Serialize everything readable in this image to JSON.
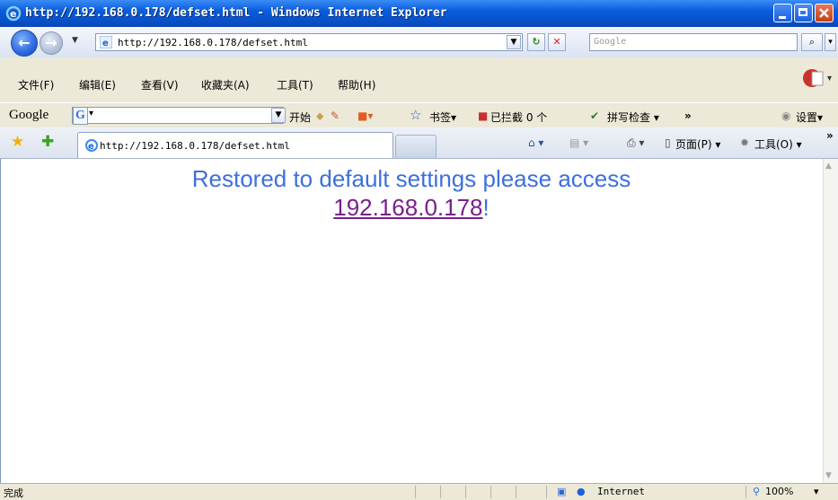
{
  "window": {
    "title": "http://192.168.0.178/defset.html - Windows Internet Explorer"
  },
  "address_bar": {
    "url": "http://192.168.0.178/defset.html",
    "search_placeholder": "Google"
  },
  "menu": {
    "items": [
      "文件(F)",
      "编辑(E)",
      "查看(V)",
      "收藏夹(A)",
      "工具(T)",
      "帮助(H)"
    ]
  },
  "google_toolbar": {
    "logo": "Google",
    "start_label": "开始",
    "bookmarks_label": "书签▾",
    "blocked_label": "已拦截 0 个",
    "spellcheck_label": "拼写检查 ▾",
    "more_label": "»",
    "settings_label": "设置▾"
  },
  "tab_row": {
    "tab_title": "http://192.168.0.178/defset.html",
    "page_menu": "页面(P) ▾",
    "tools_menu": "工具(O) ▾",
    "more": "»"
  },
  "content": {
    "message": "Restored to default settings please access",
    "link": "192.168.0.178",
    "suffix": "!"
  },
  "status_bar": {
    "status": "完成",
    "zone": "Internet",
    "zoom": "100%",
    "zoom_arrow": "▾"
  },
  "colors": {
    "message": "#3d6fe0",
    "link": "#7a1f8c",
    "titlebar": "#0a5ddc"
  }
}
